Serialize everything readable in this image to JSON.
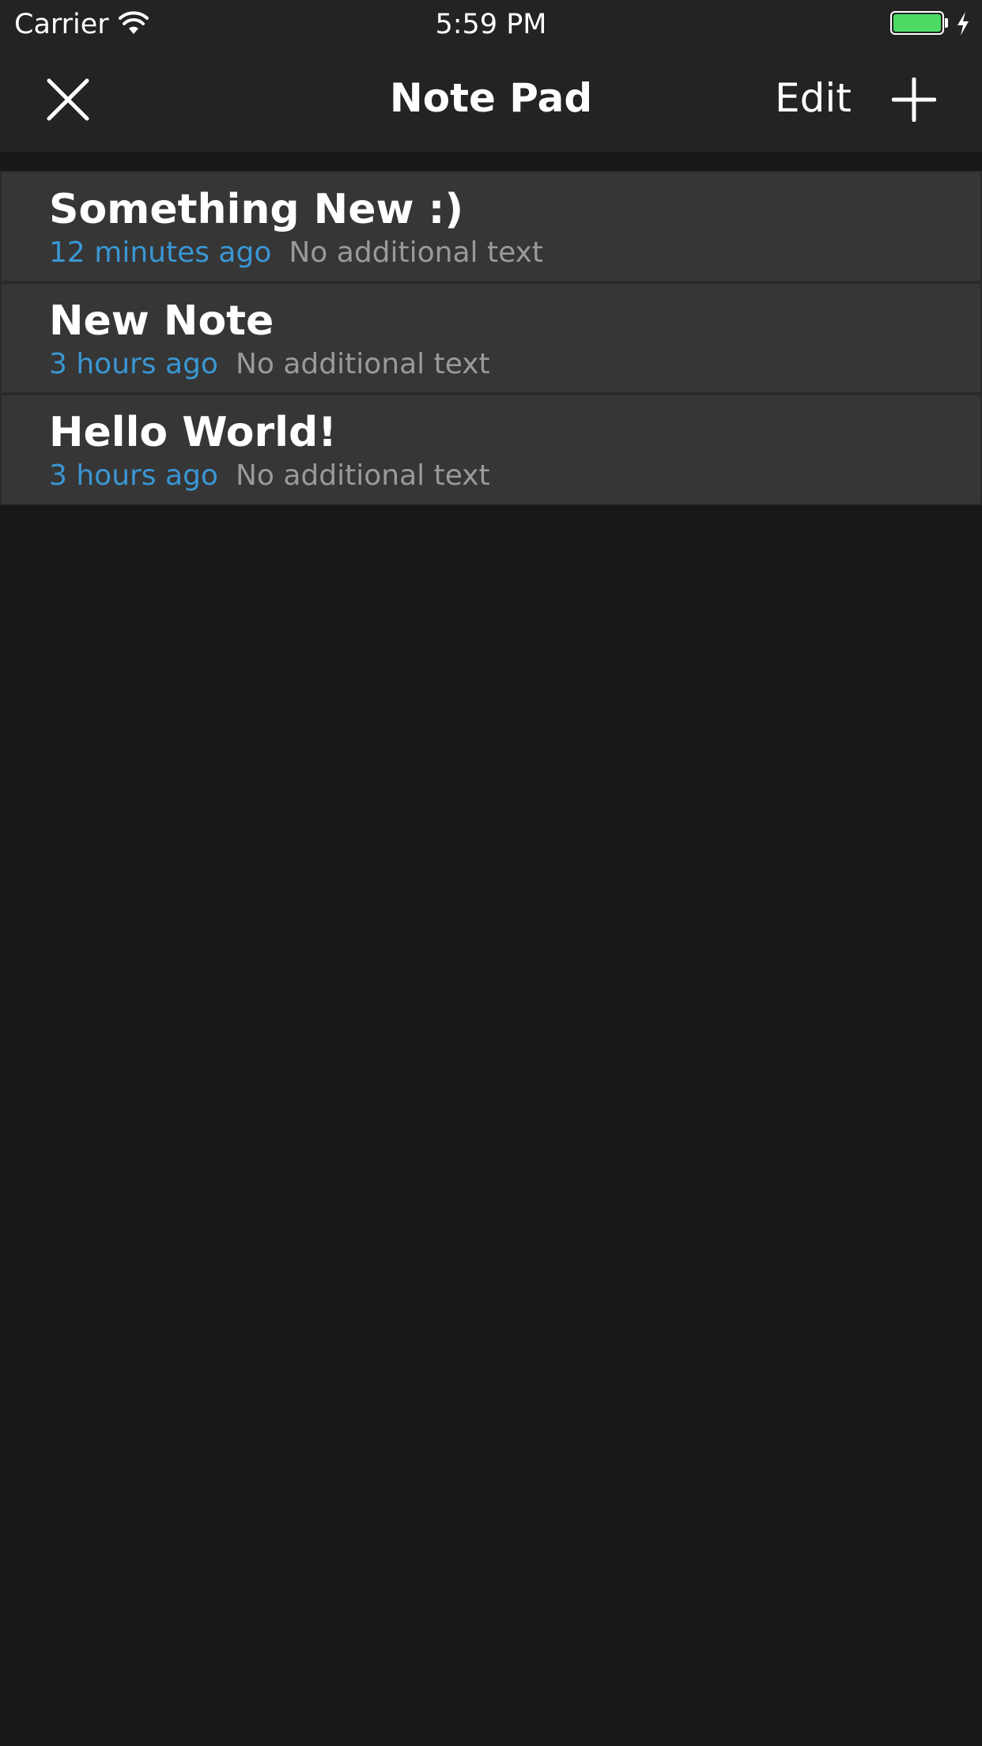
{
  "status_bar": {
    "carrier": "Carrier",
    "time": "5:59 PM",
    "battery_color": "#4cd964"
  },
  "nav": {
    "title": "Note Pad",
    "edit_label": "Edit",
    "close_icon": "close-icon",
    "add_icon": "plus-icon"
  },
  "colors": {
    "background": "#181818",
    "bar_background": "#232323",
    "row_background": "#363636",
    "timestamp": "#3a97d4",
    "preview_text": "#9a9a9a"
  },
  "notes": [
    {
      "title": "Something New :)",
      "time": "12 minutes ago",
      "preview": "No additional text"
    },
    {
      "title": "New Note",
      "time": "3 hours ago",
      "preview": "No additional text"
    },
    {
      "title": "Hello World!",
      "time": "3 hours ago",
      "preview": "No additional text"
    }
  ]
}
